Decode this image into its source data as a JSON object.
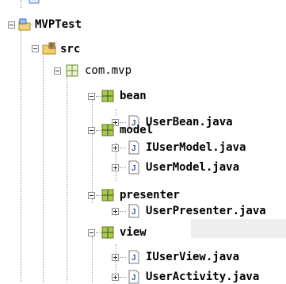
{
  "tree": {
    "project": {
      "label": "MVPTest"
    },
    "src_folder": {
      "label": "src"
    },
    "package_root": {
      "label": "com.mvp"
    },
    "bean": {
      "label": "bean",
      "files": [
        {
          "label": "UserBean.java"
        }
      ]
    },
    "model": {
      "label": "model",
      "files": [
        {
          "label": "IUserModel.java"
        },
        {
          "label": "UserModel.java"
        }
      ]
    },
    "presenter": {
      "label": "presenter",
      "files": [
        {
          "label": "UserPresenter.java"
        }
      ]
    },
    "view": {
      "label": "view",
      "files": [
        {
          "label": "IUserView.java"
        },
        {
          "label": "UserActivity.java"
        }
      ]
    }
  },
  "selected_item": "UserPresenter.java",
  "colors": {
    "selection": "#eeeeee",
    "package_icon": "#7a9a2a",
    "java_icon_letter": "#3355aa",
    "project_icon": "#5b8bd4"
  },
  "icons": {
    "project": "project-icon",
    "folder": "source-folder-icon",
    "package": "package-icon",
    "java": "java-file-icon",
    "toggle_expanded": "minus-box",
    "toggle_collapsed": "plus-box"
  }
}
